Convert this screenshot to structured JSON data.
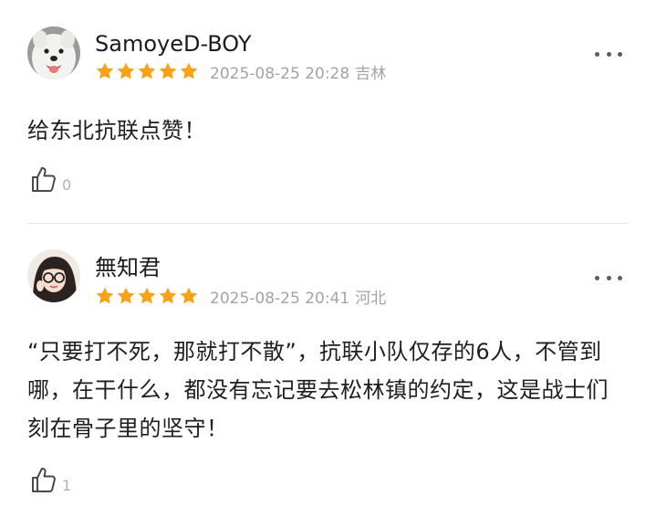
{
  "comments": [
    {
      "username": "SamoyeD-BOY",
      "rating": 5,
      "datetime": "2025-08-25 20:28",
      "location": "吉林",
      "text": "给东北抗联点赞！",
      "likes": "0"
    },
    {
      "username": "無知君",
      "rating": 5,
      "datetime": "2025-08-25 20:41",
      "location": "河北",
      "text": "“只要打不死，那就打不散”，抗联小队仅存的6人，不管到哪，在干什么，都没有忘记要去松林镇的约定，这是战士们刻在骨子里的坚守！",
      "likes": "1"
    }
  ],
  "colors": {
    "star": "#f7a31a",
    "meta_text": "#a3a3a3",
    "divider": "#e6e6e6"
  },
  "icons": {
    "rating": "star-icon",
    "like": "thumbs-up-icon",
    "menu": "more-options-icon"
  }
}
